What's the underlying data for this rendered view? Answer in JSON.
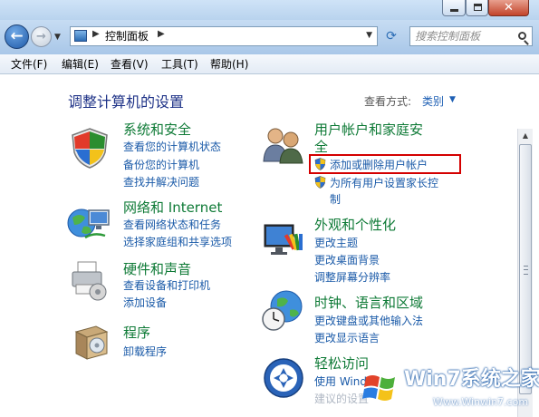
{
  "address": {
    "path": "控制面板",
    "search_placeholder": "搜索控制面板"
  },
  "menu": [
    "文件(F)",
    "编辑(E)",
    "查看(V)",
    "工具(T)",
    "帮助(H)"
  ],
  "main": {
    "heading": "调整计算机的设置",
    "view_by_label": "查看方式:",
    "view_by_value": "类别"
  },
  "categories": {
    "system": {
      "title": "系统和安全",
      "links": [
        "查看您的计算机状态",
        "备份您的计算机",
        "查找并解决问题"
      ]
    },
    "network": {
      "title": "网络和 Internet",
      "links": [
        "查看网络状态和任务",
        "选择家庭组和共享选项"
      ]
    },
    "hardware": {
      "title": "硬件和声音",
      "links": [
        "查看设备和打印机",
        "添加设备"
      ]
    },
    "programs": {
      "title": "程序",
      "links": [
        "卸载程序"
      ]
    },
    "users": {
      "title_line1": "用户帐户和家庭安",
      "title_line2": "全",
      "links": [
        "添加或删除用户帐户",
        "为所有用户设置家长控",
        "制"
      ]
    },
    "appearance": {
      "title": "外观和个性化",
      "links": [
        "更改主题",
        "更改桌面背景",
        "调整屏幕分辨率"
      ]
    },
    "clock": {
      "title": "时钟、语言和区域",
      "links": [
        "更改键盘或其他输入法",
        "更改显示语言"
      ]
    },
    "ease": {
      "title": "轻松访问",
      "links": [
        "使用 Windo",
        "建议的设置"
      ]
    }
  },
  "watermark": {
    "brand": "Win7系统之家",
    "url": "Www.Winwin7.com"
  },
  "colors": {
    "category_title": "#0e7a36",
    "link": "#1a5aa8",
    "heading": "#1e3287",
    "highlight_box": "#d40000"
  }
}
